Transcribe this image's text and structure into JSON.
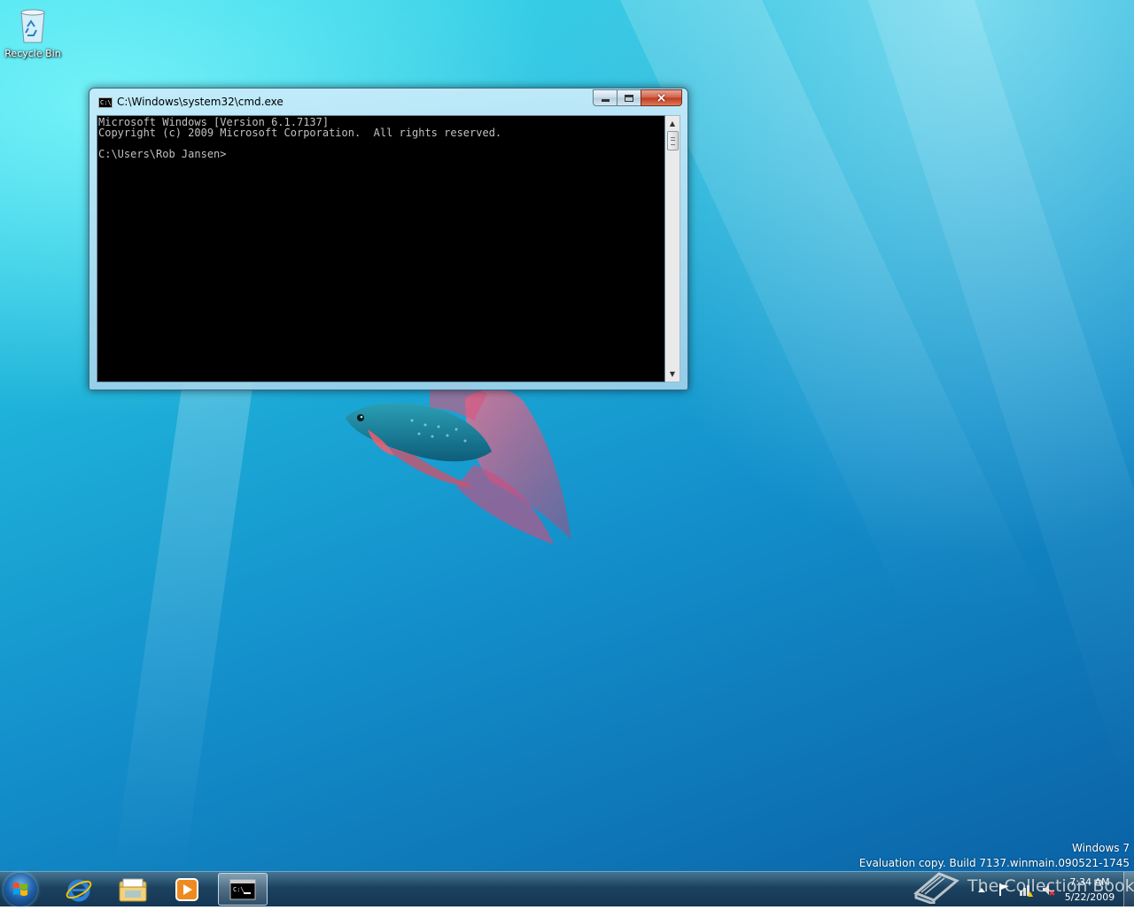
{
  "desktop": {
    "icons": [
      {
        "label": "Recycle Bin",
        "icon": "recycle-bin-icon"
      }
    ]
  },
  "cmd_window": {
    "title": "C:\\Windows\\system32\\cmd.exe",
    "icon": "command-prompt-icon",
    "icon_text": "C:\\",
    "console_lines": [
      "Microsoft Windows [Version 6.1.7137]",
      "Copyright (c) 2009 Microsoft Corporation.  All rights reserved.",
      "",
      "C:\\Users\\Rob Jansen>"
    ],
    "caption_buttons": {
      "minimize": "minimize-icon",
      "maximize": "maximize-icon",
      "close": "close-icon",
      "close_glyph": "×"
    }
  },
  "watermark": {
    "line1": "Windows 7",
    "line2": "Evaluation copy. Build 7137.winmain.090521-1745"
  },
  "taskbar": {
    "pinned": [
      {
        "name": "internet-explorer",
        "icon": "internet-explorer-icon"
      },
      {
        "name": "windows-explorer",
        "icon": "folder-icon"
      },
      {
        "name": "windows-media-player",
        "icon": "media-player-icon"
      },
      {
        "name": "command-prompt",
        "icon": "command-prompt-icon",
        "active": true
      }
    ],
    "tray_icons": [
      "show-hidden-icons-arrow",
      "flag-icon",
      "network-warning-icon",
      "volume-muted-icon"
    ],
    "clock": {
      "time": "7:34 AM",
      "date": "5/22/2009"
    }
  },
  "site_mark": {
    "text": "The Collection Book"
  },
  "colors": {
    "console_bg": "#000000",
    "console_fg": "#c0c0c0",
    "close_button": "#c7432a",
    "taskbar": "#1b4a6e"
  }
}
